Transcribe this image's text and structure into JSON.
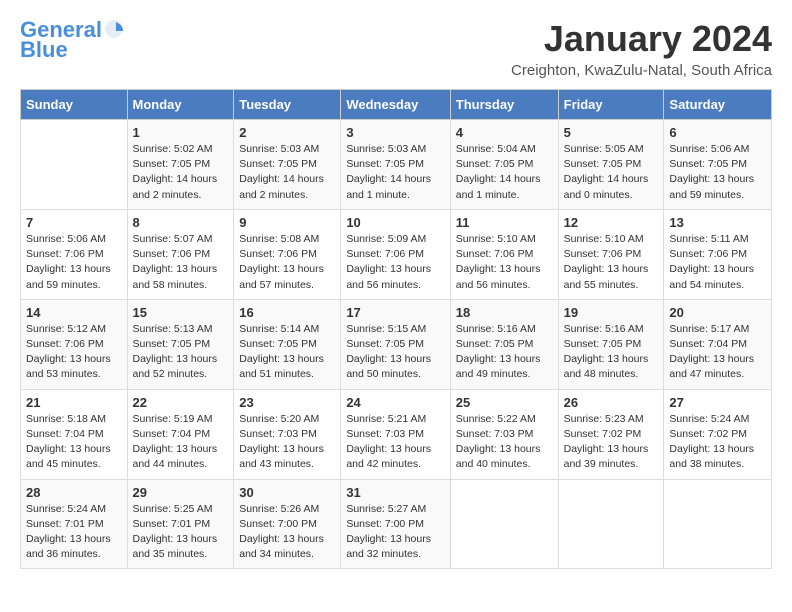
{
  "header": {
    "logo_line1": "General",
    "logo_line2": "Blue",
    "title": "January 2024",
    "subtitle": "Creighton, KwaZulu-Natal, South Africa"
  },
  "columns": [
    "Sunday",
    "Monday",
    "Tuesday",
    "Wednesday",
    "Thursday",
    "Friday",
    "Saturday"
  ],
  "weeks": [
    [
      {
        "day": "",
        "info": ""
      },
      {
        "day": "1",
        "info": "Sunrise: 5:02 AM\nSunset: 7:05 PM\nDaylight: 14 hours\nand 2 minutes."
      },
      {
        "day": "2",
        "info": "Sunrise: 5:03 AM\nSunset: 7:05 PM\nDaylight: 14 hours\nand 2 minutes."
      },
      {
        "day": "3",
        "info": "Sunrise: 5:03 AM\nSunset: 7:05 PM\nDaylight: 14 hours\nand 1 minute."
      },
      {
        "day": "4",
        "info": "Sunrise: 5:04 AM\nSunset: 7:05 PM\nDaylight: 14 hours\nand 1 minute."
      },
      {
        "day": "5",
        "info": "Sunrise: 5:05 AM\nSunset: 7:05 PM\nDaylight: 14 hours\nand 0 minutes."
      },
      {
        "day": "6",
        "info": "Sunrise: 5:06 AM\nSunset: 7:05 PM\nDaylight: 13 hours\nand 59 minutes."
      }
    ],
    [
      {
        "day": "7",
        "info": "Sunrise: 5:06 AM\nSunset: 7:06 PM\nDaylight: 13 hours\nand 59 minutes."
      },
      {
        "day": "8",
        "info": "Sunrise: 5:07 AM\nSunset: 7:06 PM\nDaylight: 13 hours\nand 58 minutes."
      },
      {
        "day": "9",
        "info": "Sunrise: 5:08 AM\nSunset: 7:06 PM\nDaylight: 13 hours\nand 57 minutes."
      },
      {
        "day": "10",
        "info": "Sunrise: 5:09 AM\nSunset: 7:06 PM\nDaylight: 13 hours\nand 56 minutes."
      },
      {
        "day": "11",
        "info": "Sunrise: 5:10 AM\nSunset: 7:06 PM\nDaylight: 13 hours\nand 56 minutes."
      },
      {
        "day": "12",
        "info": "Sunrise: 5:10 AM\nSunset: 7:06 PM\nDaylight: 13 hours\nand 55 minutes."
      },
      {
        "day": "13",
        "info": "Sunrise: 5:11 AM\nSunset: 7:06 PM\nDaylight: 13 hours\nand 54 minutes."
      }
    ],
    [
      {
        "day": "14",
        "info": "Sunrise: 5:12 AM\nSunset: 7:06 PM\nDaylight: 13 hours\nand 53 minutes."
      },
      {
        "day": "15",
        "info": "Sunrise: 5:13 AM\nSunset: 7:05 PM\nDaylight: 13 hours\nand 52 minutes."
      },
      {
        "day": "16",
        "info": "Sunrise: 5:14 AM\nSunset: 7:05 PM\nDaylight: 13 hours\nand 51 minutes."
      },
      {
        "day": "17",
        "info": "Sunrise: 5:15 AM\nSunset: 7:05 PM\nDaylight: 13 hours\nand 50 minutes."
      },
      {
        "day": "18",
        "info": "Sunrise: 5:16 AM\nSunset: 7:05 PM\nDaylight: 13 hours\nand 49 minutes."
      },
      {
        "day": "19",
        "info": "Sunrise: 5:16 AM\nSunset: 7:05 PM\nDaylight: 13 hours\nand 48 minutes."
      },
      {
        "day": "20",
        "info": "Sunrise: 5:17 AM\nSunset: 7:04 PM\nDaylight: 13 hours\nand 47 minutes."
      }
    ],
    [
      {
        "day": "21",
        "info": "Sunrise: 5:18 AM\nSunset: 7:04 PM\nDaylight: 13 hours\nand 45 minutes."
      },
      {
        "day": "22",
        "info": "Sunrise: 5:19 AM\nSunset: 7:04 PM\nDaylight: 13 hours\nand 44 minutes."
      },
      {
        "day": "23",
        "info": "Sunrise: 5:20 AM\nSunset: 7:03 PM\nDaylight: 13 hours\nand 43 minutes."
      },
      {
        "day": "24",
        "info": "Sunrise: 5:21 AM\nSunset: 7:03 PM\nDaylight: 13 hours\nand 42 minutes."
      },
      {
        "day": "25",
        "info": "Sunrise: 5:22 AM\nSunset: 7:03 PM\nDaylight: 13 hours\nand 40 minutes."
      },
      {
        "day": "26",
        "info": "Sunrise: 5:23 AM\nSunset: 7:02 PM\nDaylight: 13 hours\nand 39 minutes."
      },
      {
        "day": "27",
        "info": "Sunrise: 5:24 AM\nSunset: 7:02 PM\nDaylight: 13 hours\nand 38 minutes."
      }
    ],
    [
      {
        "day": "28",
        "info": "Sunrise: 5:24 AM\nSunset: 7:01 PM\nDaylight: 13 hours\nand 36 minutes."
      },
      {
        "day": "29",
        "info": "Sunrise: 5:25 AM\nSunset: 7:01 PM\nDaylight: 13 hours\nand 35 minutes."
      },
      {
        "day": "30",
        "info": "Sunrise: 5:26 AM\nSunset: 7:00 PM\nDaylight: 13 hours\nand 34 minutes."
      },
      {
        "day": "31",
        "info": "Sunrise: 5:27 AM\nSunset: 7:00 PM\nDaylight: 13 hours\nand 32 minutes."
      },
      {
        "day": "",
        "info": ""
      },
      {
        "day": "",
        "info": ""
      },
      {
        "day": "",
        "info": ""
      }
    ]
  ]
}
